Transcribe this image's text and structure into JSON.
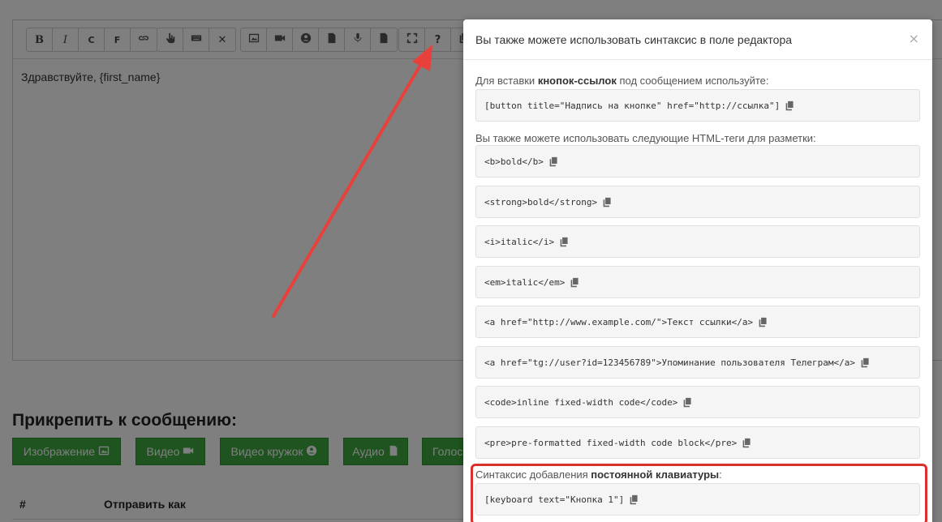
{
  "editor": {
    "text": "Здравствуйте, {first_name}",
    "toolbar": [
      {
        "group": "format",
        "items": [
          "B",
          "I",
          "C",
          "F",
          "link-icon"
        ]
      },
      {
        "group": "insert",
        "items": [
          "pointer-icon",
          "keyboard-icon",
          "close-icon"
        ]
      },
      {
        "group": "media",
        "items": [
          "image-icon",
          "video-icon",
          "circle-video-icon",
          "audio-file-icon",
          "mic-icon",
          "document-icon"
        ]
      },
      {
        "group": "help",
        "items": [
          "fullscreen-icon",
          "?",
          "copy-icon"
        ]
      }
    ]
  },
  "attach": {
    "title": "Прикрепить к сообщению:",
    "buttons": [
      {
        "label": "Изображение",
        "icon": "image-icon"
      },
      {
        "label": "Видео",
        "icon": "video-icon"
      },
      {
        "label": "Видео кружок",
        "icon": "circle-icon"
      },
      {
        "label": "Аудио",
        "icon": "audio-file-icon"
      },
      {
        "label": "Голос",
        "icon": ""
      }
    ]
  },
  "table": {
    "col_num": "#",
    "col_send_as": "Отправить как"
  },
  "modal": {
    "title": "Вы также можете использовать синтаксис в поле редактора",
    "close": "×",
    "buttons_label_pre": "Для вставки ",
    "buttons_label_bold": "кнопок-ссылок",
    "buttons_label_post": " под сообщением используйте:",
    "button_code": "[button title=\"Надпись на кнопке\" href=\"http://ссылка\"]",
    "html_label": "Вы также можете использовать следующие HTML-теги для разметки:",
    "tags": [
      "<b>bold</b>",
      "<strong>bold</strong>",
      "<i>italic</i>",
      "<em>italic</em>",
      "<a href=\"http://www.example.com/\">Текст ссылки</a>",
      "<a href=\"tg://user?id=123456789\">Упоминание пользователя Телеграм</a>",
      "<code>inline fixed-width code</code>",
      "<pre>pre-formatted fixed-width code block</pre>"
    ],
    "keyboard_label_pre": "Синтаксис добавления ",
    "keyboard_label_bold": "постоянной клавиатуры",
    "keyboard_label_post": ":",
    "keyboard_code": "[keyboard text=\"Кнопка 1\"]"
  },
  "colors": {
    "green": "#3ea840",
    "highlight": "#d9302b",
    "arrow": "#e8403a"
  }
}
